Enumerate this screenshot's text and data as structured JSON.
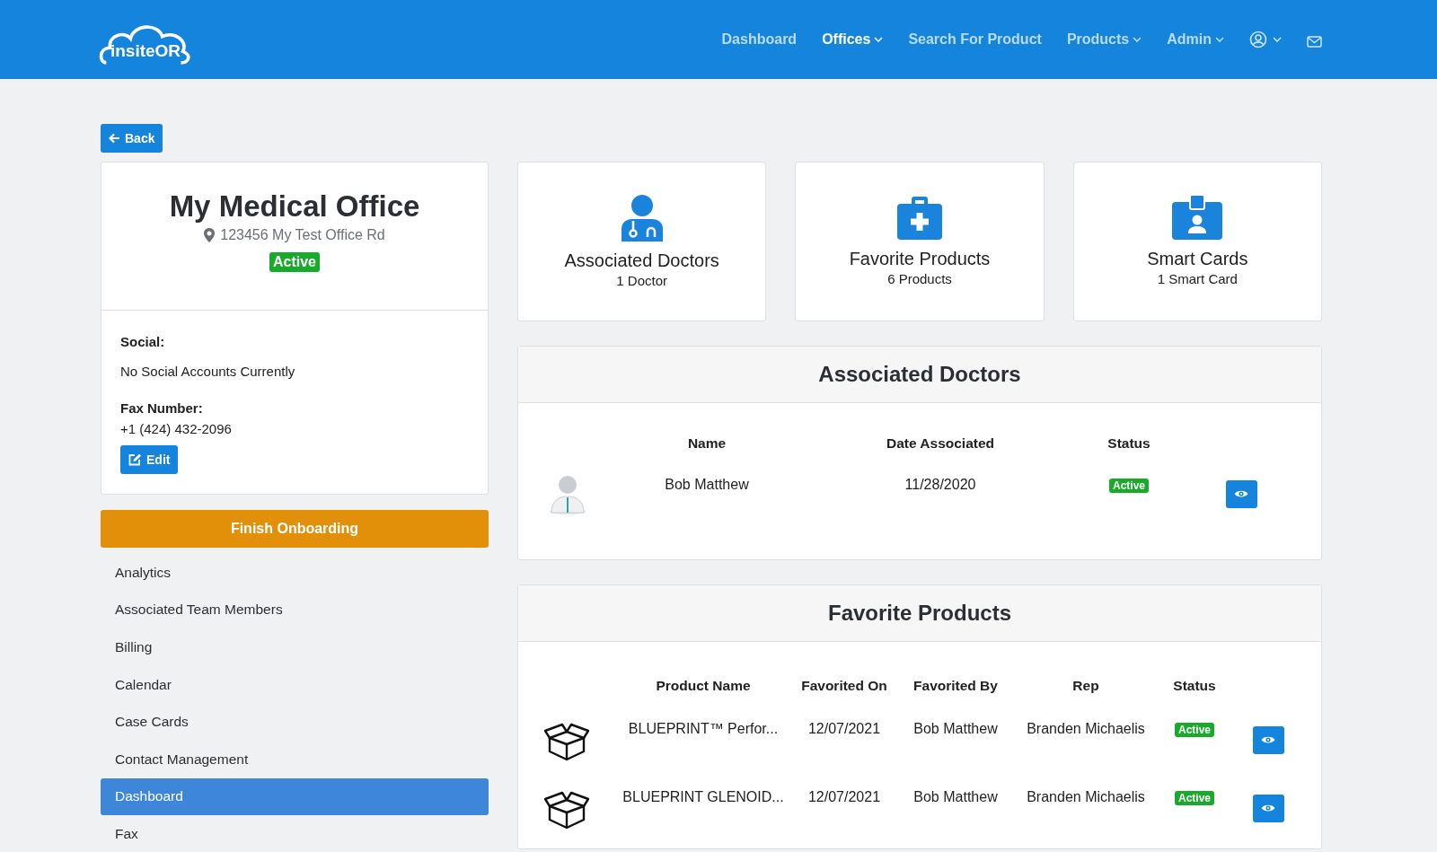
{
  "header": {
    "logo": "insiteOR",
    "nav": [
      {
        "label": "Dashboard",
        "selected": false,
        "dropdown": false
      },
      {
        "label": "Offices",
        "selected": true,
        "dropdown": true
      },
      {
        "label": "Search For Product",
        "selected": false,
        "dropdown": false
      },
      {
        "label": "Products",
        "selected": false,
        "dropdown": true
      },
      {
        "label": "Admin",
        "selected": false,
        "dropdown": true
      }
    ]
  },
  "back_button": "Back",
  "office": {
    "name": "My Medical Office",
    "address": "123456 My Test Office Rd",
    "status": "Active",
    "social_label": "Social:",
    "social_value": "No Social Accounts Currently",
    "fax_label": "Fax Number:",
    "fax_value": "+1 (424) 432-2096",
    "edit_button": "Edit"
  },
  "finish_onboarding": "Finish Onboarding",
  "sidebar": {
    "items": [
      {
        "label": "Analytics",
        "selected": false
      },
      {
        "label": "Associated Team Members",
        "selected": false
      },
      {
        "label": "Billing",
        "selected": false
      },
      {
        "label": "Calendar",
        "selected": false
      },
      {
        "label": "Case Cards",
        "selected": false
      },
      {
        "label": "Contact Management",
        "selected": false
      },
      {
        "label": "Dashboard",
        "selected": true
      },
      {
        "label": "Fax",
        "selected": false
      }
    ]
  },
  "stat_cards": [
    {
      "kind": "doctor",
      "title": "Associated Doctors",
      "count": "1 Doctor"
    },
    {
      "kind": "kit",
      "title": "Favorite Products",
      "count": "6 Products"
    },
    {
      "kind": "badge",
      "title": "Smart Cards",
      "count": "1 Smart Card"
    }
  ],
  "doctors_panel": {
    "title": "Associated Doctors",
    "columns": [
      "Name",
      "Date Associated",
      "Status"
    ],
    "rows": [
      {
        "name": "Bob Matthew",
        "date": "11/28/2020",
        "status": "Active"
      }
    ]
  },
  "products_panel": {
    "title": "Favorite Products",
    "columns": [
      "Product Name",
      "Favorited On",
      "Favorited By",
      "Rep",
      "Status"
    ],
    "rows": [
      {
        "product": "BLUEPRINT™ Perfor...",
        "favorited_on": "12/07/2021",
        "favorited_by": "Bob Matthew",
        "rep": "Branden Michaelis",
        "status": "Active"
      },
      {
        "product": "BLUEPRINT GLENOID...",
        "favorited_on": "12/07/2021",
        "favorited_by": "Bob Matthew",
        "rep": "Branden Michaelis",
        "status": "Active"
      }
    ]
  }
}
